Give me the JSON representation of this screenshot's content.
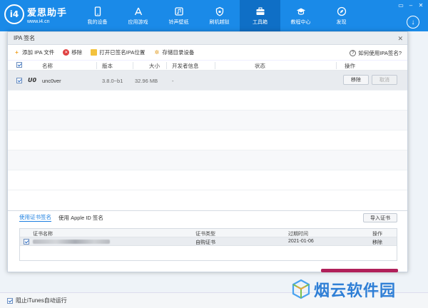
{
  "app": {
    "logo_badge": "i4",
    "name": "爱思助手",
    "url": "www.i4.cn"
  },
  "nav": [
    {
      "label": "我的设备",
      "icon": "phone-icon"
    },
    {
      "label": "应用游戏",
      "icon": "appstore-icon"
    },
    {
      "label": "铃声壁纸",
      "icon": "music-icon"
    },
    {
      "label": "刷机越狱",
      "icon": "lock-icon"
    },
    {
      "label": "工具箱",
      "icon": "toolbox-icon",
      "active": true
    },
    {
      "label": "教程中心",
      "icon": "graduation-icon"
    },
    {
      "label": "发现",
      "icon": "compass-icon"
    }
  ],
  "window_controls": [
    "▭",
    "–",
    "✕"
  ],
  "dialog": {
    "title": "IPA 签名",
    "close": "✕",
    "toolbar": {
      "add": "添加 IPA 文件",
      "remove": "移除",
      "open_location": "打开已签名IPA位置",
      "storage": "存储目录设备",
      "help": "如何使用IPA签名?"
    },
    "columns": {
      "name": "名称",
      "version": "版本",
      "size": "大小",
      "developer": "开发者信息",
      "status": "状态",
      "action": "操作"
    },
    "rows": [
      {
        "logo": "U0",
        "name": "unc0ver",
        "version": "3.8.0~b1",
        "size": "32.96 MB",
        "developer": "-",
        "status": "",
        "remove": "移除",
        "cancel": "取消"
      }
    ],
    "cert": {
      "tab_cert": "使用证书签名",
      "tab_apple": "使用 Apple ID 签名",
      "import": "导入证书",
      "columns": {
        "name": "证书名称",
        "type": "证书类型",
        "expiry": "过期时间",
        "action": "操作"
      },
      "row": {
        "type": "自购证书",
        "expiry": "2021-01-06",
        "action": "移除"
      }
    }
  },
  "footer": {
    "itunes": "阻止iTunes自动运行"
  },
  "watermark": {
    "text": "烟云软件园"
  }
}
